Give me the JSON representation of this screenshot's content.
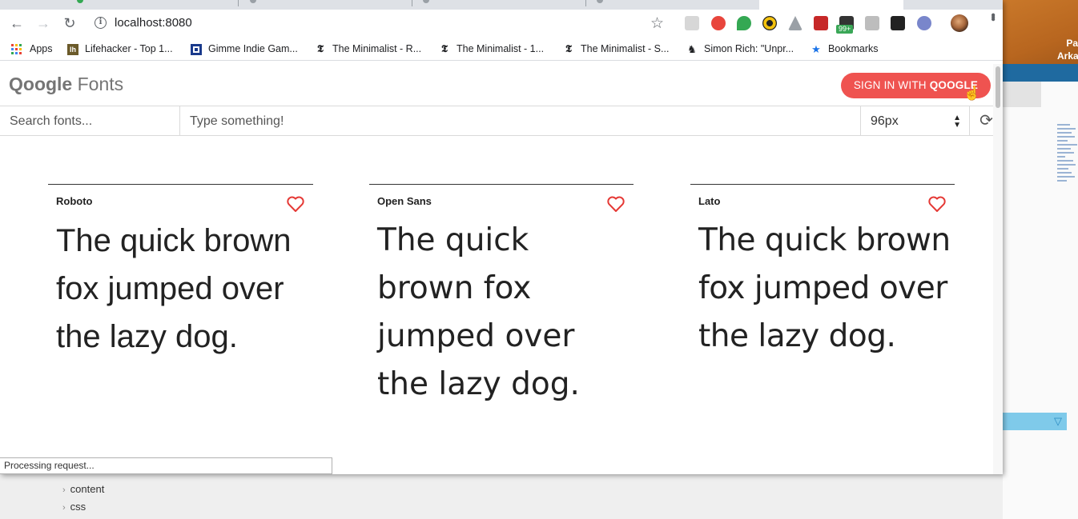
{
  "browser": {
    "url": "localhost:8080",
    "bookmarks": [
      {
        "icon": "apps-grid-icon",
        "label": "Apps"
      },
      {
        "icon": "lifehacker-icon",
        "label": "Lifehacker - Top 1..."
      },
      {
        "icon": "gimme-indie-icon",
        "label": "Gimme Indie Gam..."
      },
      {
        "icon": "nyt-icon",
        "label": "The Minimalist - R..."
      },
      {
        "icon": "nyt-icon",
        "label": "The Minimalist - 1..."
      },
      {
        "icon": "nyt-icon",
        "label": "The Minimalist - S..."
      },
      {
        "icon": "piano-icon",
        "label": "Simon Rich: \"Unpr..."
      },
      {
        "icon": "star-icon",
        "label": "Bookmarks"
      }
    ],
    "extension_badge": "99+",
    "status": "Processing request..."
  },
  "app": {
    "brand_bold": "Qoogle",
    "brand_rest": " Fonts",
    "signin_prefix": "SIGN IN WITH ",
    "signin_bold": "QOOGLE",
    "search_placeholder": "Search fonts...",
    "sample_placeholder": "Type something!",
    "font_size": "96px"
  },
  "fonts": [
    {
      "name": "Roboto",
      "sample": "The quick brown fox jumped over the lazy dog."
    },
    {
      "name": "Open Sans",
      "sample": "The quick brown fox jumped over the lazy dog."
    },
    {
      "name": "Lato",
      "sample": "The quick brown fox jumped over the lazy dog."
    }
  ],
  "background": {
    "orange_text": "Pa Arka",
    "tree_items": [
      "content",
      "css"
    ]
  },
  "colors": {
    "accent": "#ef5350",
    "heart": "#e53935"
  }
}
